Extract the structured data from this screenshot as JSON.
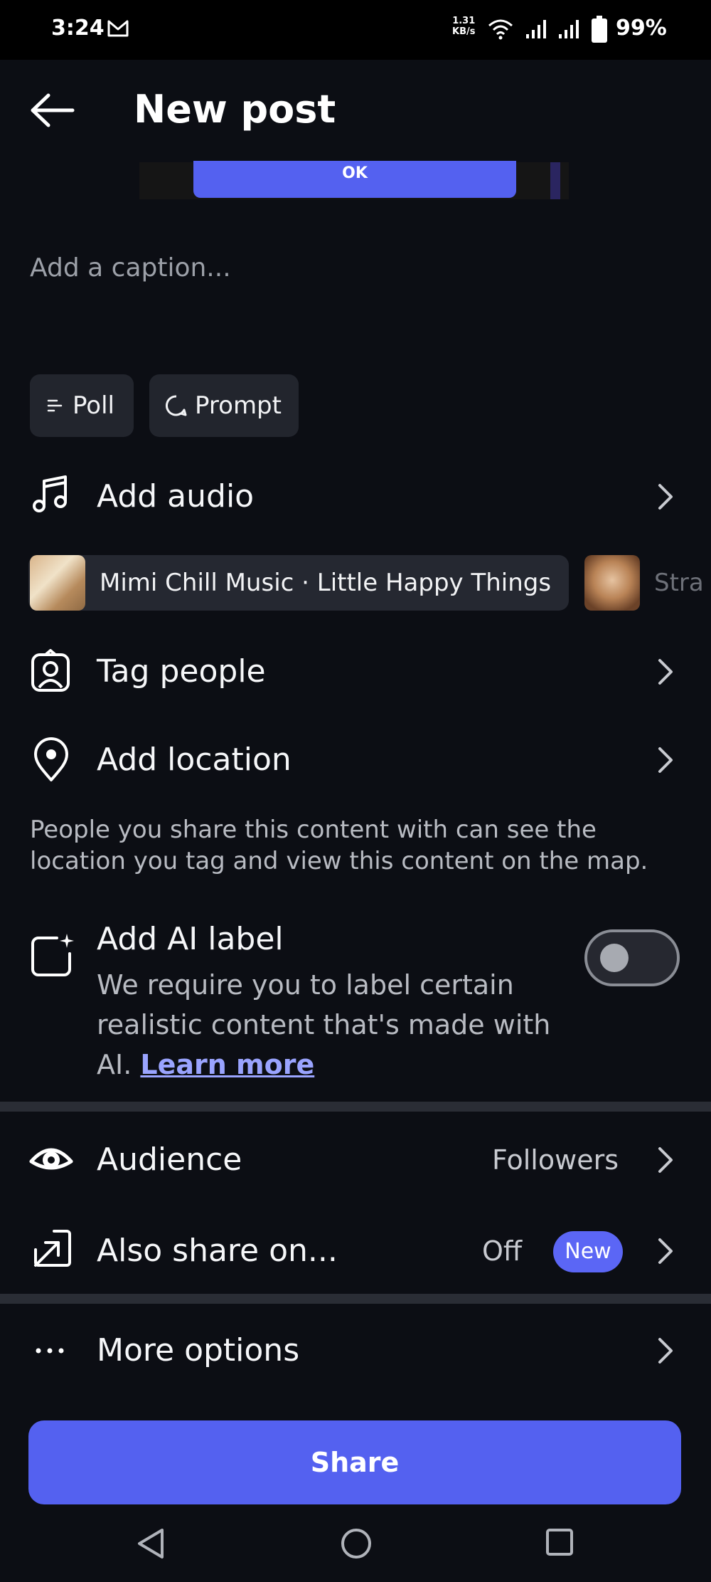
{
  "status_bar": {
    "time": "3:24",
    "network_speed_value": "1.31",
    "network_speed_unit": "KB/s",
    "battery": "99%"
  },
  "header": {
    "title": "New post"
  },
  "preview": {
    "button_label": "OK"
  },
  "caption": {
    "placeholder": "Add a caption..."
  },
  "chips": {
    "poll": "Poll",
    "prompt": "Prompt"
  },
  "audio": {
    "label": "Add audio",
    "suggestion": "Mimi Chill Music · Little Happy Things",
    "next_suggestion": "Stra"
  },
  "tag_people": {
    "label": "Tag people"
  },
  "location": {
    "label": "Add location",
    "note": "People you share this content with can see the location you tag and view this content on the map."
  },
  "ai_label": {
    "title": "Add AI label",
    "description": "We require you to label certain realistic content that's made with AI.",
    "link": "Learn more",
    "enabled": false
  },
  "audience": {
    "label": "Audience",
    "value": "Followers"
  },
  "also_share": {
    "label": "Also share on...",
    "value": "Off",
    "badge": "New"
  },
  "more_options": {
    "label": "More options"
  },
  "share_button": {
    "label": "Share"
  },
  "colors": {
    "background": "#0c0e14",
    "accent": "#5461f0",
    "link": "#9aa4ff"
  },
  "icons": {
    "back": "arrow-left-icon",
    "audio": "music-note-icon",
    "tag": "person-square-icon",
    "location": "map-pin-icon",
    "ai": "ai-sparkle-square-icon",
    "audience": "eye-icon",
    "share_on": "share-arrow-icon",
    "more": "ellipsis-icon",
    "chevron": "chevron-right-icon"
  }
}
